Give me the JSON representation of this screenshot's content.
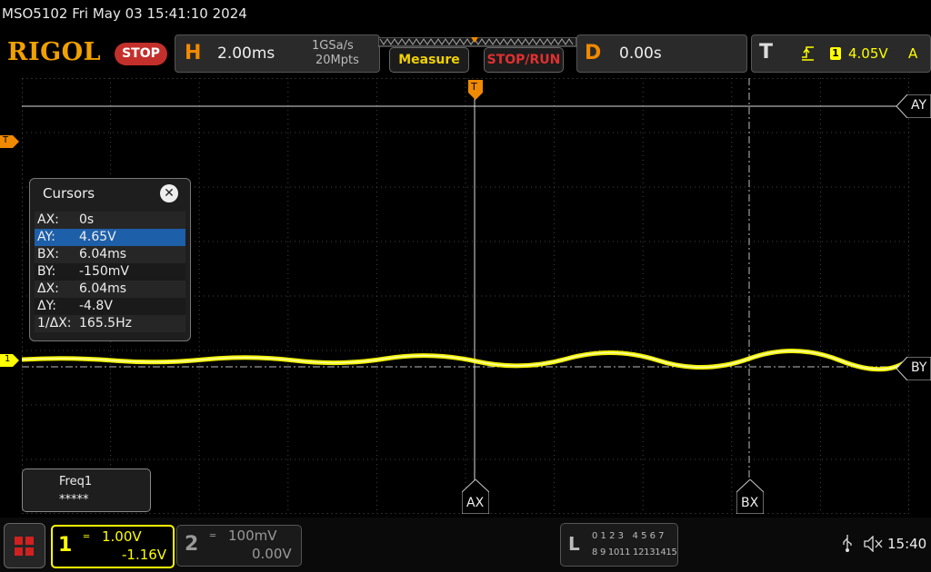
{
  "header": {
    "model_time": "MSO5102  Fri May 03 15:41:10 2024",
    "brand": "RIGOL",
    "run_state": "STOP",
    "horizontal": {
      "letter": "H",
      "scale": "2.00ms",
      "sample_rate": "1GSa/s",
      "memory_depth": "20Mpts"
    },
    "measure_label": "Measure",
    "stop_run_label": "STOP/RUN",
    "delay": {
      "letter": "D",
      "value": "0.00s"
    },
    "trigger": {
      "letter": "T",
      "channel": "1",
      "level": "4.05V",
      "mode": "A"
    }
  },
  "markers": {
    "trigger_left": "T",
    "channel1_left": "1",
    "ay": "AY",
    "by": "BY",
    "ax": "AX",
    "bx": "BX"
  },
  "cursors": {
    "title": "Cursors",
    "close_glyph": "✕",
    "rows": [
      {
        "key": "AX:",
        "value": "0s"
      },
      {
        "key": "AY:",
        "value": "4.65V"
      },
      {
        "key": "BX:",
        "value": "6.04ms"
      },
      {
        "key": "BY:",
        "value": "-150mV"
      },
      {
        "key": "ΔX:",
        "value": "6.04ms"
      },
      {
        "key": "ΔY:",
        "value": "-4.8V"
      },
      {
        "key": "1/ΔX:",
        "value": "165.5Hz"
      }
    ],
    "selected_row": 1
  },
  "measure_item": {
    "label": "Freq1",
    "value": "*****"
  },
  "channels": [
    {
      "num": "1",
      "scale": "1.00V",
      "offset": "-1.16V",
      "color": "#ffff00",
      "active": true
    },
    {
      "num": "2",
      "scale": "100mV",
      "offset": "0.00V",
      "color": "#999999",
      "active": false
    }
  ],
  "logic": {
    "letter": "L",
    "row1": "0 1 2 3   4 5 6 7",
    "row2": "8 9 1011 12131415"
  },
  "status": {
    "time": "15:40"
  },
  "colors": {
    "ch1": "#ffff00",
    "accent": "#f08a00",
    "stop": "#c3302c",
    "selected": "#1d5fa8"
  }
}
